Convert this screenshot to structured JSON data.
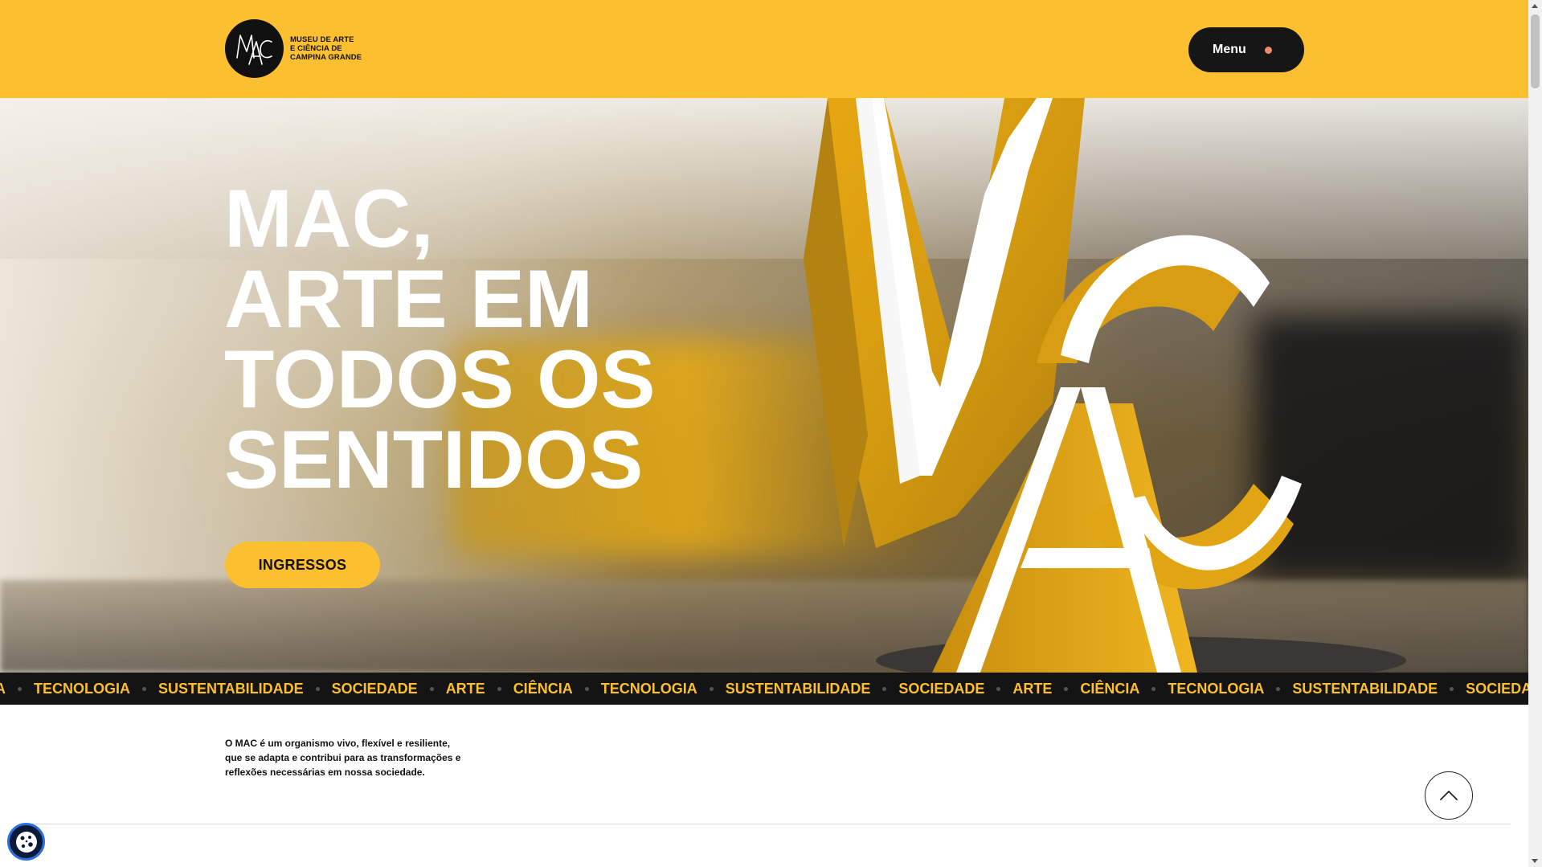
{
  "header": {
    "logo_lines": [
      "MUSEU DE ARTE",
      "E CIÊNCIA DE",
      "CAMPINA GRANDE"
    ],
    "menu_label": "Menu"
  },
  "hero": {
    "title_lines": [
      "MAC,",
      "ARTE EM",
      "TODOS OS",
      "SENTIDOS"
    ],
    "cta_label": "INGRESSOS"
  },
  "ticker": {
    "items": [
      "A",
      "TECNOLOGIA",
      "SUSTENTABILIDADE",
      "SOCIEDADE",
      "ARTE",
      "CIÊNCIA",
      "TECNOLOGIA",
      "SUSTENTABILIDADE",
      "SOCIEDADE",
      "ARTE",
      "CIÊNCIA",
      "TECNOLOGIA",
      "SUSTENTABILIDADE",
      "SOCIEDADE"
    ]
  },
  "intro": {
    "text": "O MAC é um organismo vivo, flexível e resiliente, que se adapta e contribui para as transformações e reflexões necessárias em nossa sociedade."
  },
  "icons": {
    "logo": "mac-logo-icon",
    "menu_indicator": "dot-icon",
    "scroll_top": "chevron-up-icon",
    "cookie": "cookie-icon"
  },
  "colors": {
    "brand_yellow": "#fcbf30",
    "dark": "#141414",
    "menu_dot": "#f08a6e"
  }
}
